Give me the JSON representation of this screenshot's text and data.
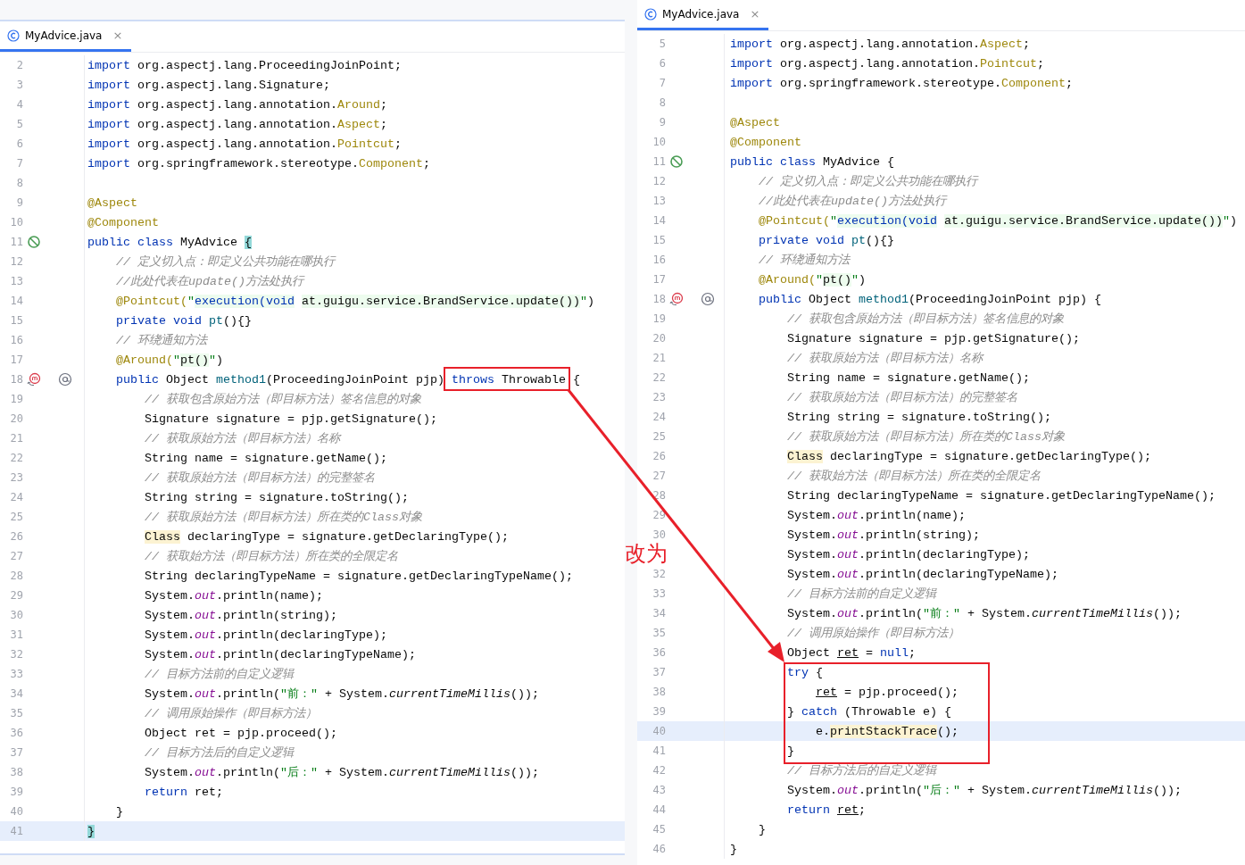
{
  "panes": [
    {
      "tab": {
        "title": "MyAdvice.java",
        "close": "×",
        "selected": true
      },
      "lines": [
        {
          "n": "2",
          "current": false,
          "toks": [
            {
              "text": "import",
              "kind": "kw"
            },
            {
              "text": " org.aspectj.lang.ProceedingJoinPoint;",
              "kind": "plain"
            }
          ]
        },
        {
          "n": "3",
          "current": false,
          "toks": [
            {
              "text": "import",
              "kind": "kw"
            },
            {
              "text": " org.aspectj.lang.Signature;",
              "kind": "plain"
            }
          ]
        },
        {
          "n": "4",
          "current": false,
          "toks": [
            {
              "text": "import",
              "kind": "kw"
            },
            {
              "text": " org.aspectj.lang.annotation.",
              "kind": "plain"
            },
            {
              "text": "Around",
              "kind": "ann"
            },
            {
              "text": ";",
              "kind": "plain"
            }
          ]
        },
        {
          "n": "5",
          "current": false,
          "toks": [
            {
              "text": "import",
              "kind": "kw"
            },
            {
              "text": " org.aspectj.lang.annotation.",
              "kind": "plain"
            },
            {
              "text": "Aspect",
              "kind": "ann"
            },
            {
              "text": ";",
              "kind": "plain"
            }
          ]
        },
        {
          "n": "6",
          "current": false,
          "toks": [
            {
              "text": "import",
              "kind": "kw"
            },
            {
              "text": " org.aspectj.lang.annotation.",
              "kind": "plain"
            },
            {
              "text": "Pointcut",
              "kind": "ann"
            },
            {
              "text": ";",
              "kind": "plain"
            }
          ]
        },
        {
          "n": "7",
          "current": false,
          "toks": [
            {
              "text": "import",
              "kind": "kw"
            },
            {
              "text": " org.springframework.stereotype.",
              "kind": "plain"
            },
            {
              "text": "Component",
              "kind": "ann"
            },
            {
              "text": ";",
              "kind": "plain"
            }
          ]
        },
        {
          "n": "8",
          "current": false
        },
        {
          "n": "9",
          "current": false,
          "toks": [
            {
              "text": "@Aspect",
              "kind": "ann"
            }
          ]
        },
        {
          "n": "10",
          "current": false,
          "toks": [
            {
              "text": "@Component",
              "kind": "ann"
            }
          ]
        },
        {
          "n": "11",
          "current": false,
          "icons": [
            {
              "kind": "bean"
            }
          ],
          "toks": [
            {
              "text": "public class",
              "kind": "kw"
            },
            {
              "text": " MyAdvice ",
              "kind": "plain"
            },
            {
              "text": "{",
              "kind": "brace"
            }
          ]
        },
        {
          "n": "12",
          "current": false,
          "toks": [
            {
              "text": "    // 定义切入点：即定义公共功能在哪执行",
              "kind": "cmt"
            }
          ]
        },
        {
          "n": "13",
          "current": false,
          "toks": [
            {
              "text": "    //此处代表在update()方法处执行",
              "kind": "cmt"
            }
          ]
        },
        {
          "n": "14",
          "current": false,
          "toks": [
            {
              "text": "    @Pointcut(",
              "kind": "ann"
            },
            {
              "text": "\"",
              "kind": "str"
            },
            {
              "text": "execution(void",
              "kind": "injkw"
            },
            {
              "text": " at.guigu.service.BrandService.update())",
              "kind": "injplain"
            },
            {
              "text": "\"",
              "kind": "str"
            },
            {
              "text": ")",
              "kind": "plain"
            }
          ]
        },
        {
          "n": "15",
          "current": false,
          "toks": [
            {
              "text": "    private void",
              "kind": "kw"
            },
            {
              "text": " pt",
              "kind": "decl"
            },
            {
              "text": "(){}",
              "kind": "plain"
            }
          ]
        },
        {
          "n": "16",
          "current": false,
          "toks": [
            {
              "text": "    // 环绕通知方法",
              "kind": "cmt"
            }
          ]
        },
        {
          "n": "17",
          "current": false,
          "toks": [
            {
              "text": "    @Around(",
              "kind": "ann"
            },
            {
              "text": "\"",
              "kind": "str"
            },
            {
              "text": "pt()",
              "kind": "injplain"
            },
            {
              "text": "\"",
              "kind": "str"
            },
            {
              "text": ")",
              "kind": "plain"
            }
          ]
        },
        {
          "n": "18",
          "current": false,
          "icons": [
            {
              "kind": "method"
            },
            {
              "kind": "annotation"
            }
          ],
          "toks": [
            {
              "text": "    public",
              "kind": "kw"
            },
            {
              "text": " Object ",
              "kind": "plain"
            },
            {
              "text": "method1",
              "kind": "decl"
            },
            {
              "text": "(ProceedingJoinPoint pjp) ",
              "kind": "plain"
            },
            {
              "text": "throws",
              "kind": "kw"
            },
            {
              "text": " Throwable {",
              "kind": "plain"
            }
          ]
        },
        {
          "n": "19",
          "current": false,
          "toks": [
            {
              "text": "        // 获取包含原始方法（即目标方法）签名信息的对象",
              "kind": "cmt"
            }
          ]
        },
        {
          "n": "20",
          "current": false,
          "toks": [
            {
              "text": "        Signature signature = pjp.getSignature();",
              "kind": "plain"
            }
          ]
        },
        {
          "n": "21",
          "current": false,
          "toks": [
            {
              "text": "        // 获取原始方法（即目标方法）名称",
              "kind": "cmt"
            }
          ]
        },
        {
          "n": "22",
          "current": false,
          "toks": [
            {
              "text": "        String name = signature.getName();",
              "kind": "plain"
            }
          ]
        },
        {
          "n": "23",
          "current": false,
          "toks": [
            {
              "text": "        // 获取原始方法（即目标方法）的完整签名",
              "kind": "cmt"
            }
          ]
        },
        {
          "n": "24",
          "current": false,
          "toks": [
            {
              "text": "        String string = signature.toString();",
              "kind": "plain"
            }
          ]
        },
        {
          "n": "25",
          "current": false,
          "toks": [
            {
              "text": "        // 获取原始方法（即目标方法）所在类的Class对象",
              "kind": "cmt"
            }
          ]
        },
        {
          "n": "26",
          "current": false,
          "toks": [
            {
              "text": "        Class",
              "kind": "warn"
            },
            {
              "text": " declaringType = signature.getDeclaringType();",
              "kind": "plain"
            }
          ]
        },
        {
          "n": "27",
          "current": false,
          "toks": [
            {
              "text": "        // 获取始方法（即目标方法）所在类的全限定名",
              "kind": "cmt"
            }
          ]
        },
        {
          "n": "28",
          "current": false,
          "toks": [
            {
              "text": "        String declaringTypeName = signature.getDeclaringTypeName();",
              "kind": "plain"
            }
          ]
        },
        {
          "n": "29",
          "current": false,
          "toks": [
            {
              "text": "        System.",
              "kind": "plain"
            },
            {
              "text": "out",
              "kind": "field"
            },
            {
              "text": ".println(name);",
              "kind": "plain"
            }
          ]
        },
        {
          "n": "30",
          "current": false,
          "toks": [
            {
              "text": "        System.",
              "kind": "plain"
            },
            {
              "text": "out",
              "kind": "field"
            },
            {
              "text": ".println(string);",
              "kind": "plain"
            }
          ]
        },
        {
          "n": "31",
          "current": false,
          "toks": [
            {
              "text": "        System.",
              "kind": "plain"
            },
            {
              "text": "out",
              "kind": "field"
            },
            {
              "text": ".println(declaringType);",
              "kind": "plain"
            }
          ]
        },
        {
          "n": "32",
          "current": false,
          "toks": [
            {
              "text": "        System.",
              "kind": "plain"
            },
            {
              "text": "out",
              "kind": "field"
            },
            {
              "text": ".println(declaringTypeName);",
              "kind": "plain"
            }
          ]
        },
        {
          "n": "33",
          "current": false,
          "toks": [
            {
              "text": "        // 目标方法前的自定义逻辑",
              "kind": "cmt"
            }
          ]
        },
        {
          "n": "34",
          "current": false,
          "toks": [
            {
              "text": "        System.",
              "kind": "plain"
            },
            {
              "text": "out",
              "kind": "field"
            },
            {
              "text": ".println(",
              "kind": "plain"
            },
            {
              "text": "\"前：\"",
              "kind": "str"
            },
            {
              "text": " + System.",
              "kind": "plain"
            },
            {
              "text": "currentTimeMillis",
              "kind": "static"
            },
            {
              "text": "());",
              "kind": "plain"
            }
          ]
        },
        {
          "n": "35",
          "current": false,
          "toks": [
            {
              "text": "        // 调用原始操作（即目标方法）",
              "kind": "cmt"
            }
          ]
        },
        {
          "n": "36",
          "current": false,
          "toks": [
            {
              "text": "        Object ret = pjp.proceed();",
              "kind": "plain"
            }
          ]
        },
        {
          "n": "37",
          "current": false,
          "toks": [
            {
              "text": "        // 目标方法后的自定义逻辑",
              "kind": "cmt"
            }
          ]
        },
        {
          "n": "38",
          "current": false,
          "toks": [
            {
              "text": "        System.",
              "kind": "plain"
            },
            {
              "text": "out",
              "kind": "field"
            },
            {
              "text": ".println(",
              "kind": "plain"
            },
            {
              "text": "\"后：\"",
              "kind": "str"
            },
            {
              "text": " + System.",
              "kind": "plain"
            },
            {
              "text": "currentTimeMillis",
              "kind": "static"
            },
            {
              "text": "());",
              "kind": "plain"
            }
          ]
        },
        {
          "n": "39",
          "current": false,
          "toks": [
            {
              "text": "        return",
              "kind": "kw"
            },
            {
              "text": " ret;",
              "kind": "plain"
            }
          ]
        },
        {
          "n": "40",
          "current": false,
          "toks": [
            {
              "text": "    }",
              "kind": "plain"
            }
          ]
        },
        {
          "n": "41",
          "current": true,
          "toks": [
            {
              "text": "}",
              "kind": "brace"
            }
          ]
        }
      ]
    },
    {
      "tab": {
        "title": "MyAdvice.java",
        "close": "×",
        "selected": true
      },
      "lines": [
        {
          "n": "5",
          "current": false,
          "toks": [
            {
              "text": "import",
              "kind": "kw"
            },
            {
              "text": " org.aspectj.lang.annotation.",
              "kind": "plain"
            },
            {
              "text": "Aspect",
              "kind": "ann"
            },
            {
              "text": ";",
              "kind": "plain"
            }
          ]
        },
        {
          "n": "6",
          "current": false,
          "toks": [
            {
              "text": "import",
              "kind": "kw"
            },
            {
              "text": " org.aspectj.lang.annotation.",
              "kind": "plain"
            },
            {
              "text": "Pointcut",
              "kind": "ann"
            },
            {
              "text": ";",
              "kind": "plain"
            }
          ]
        },
        {
          "n": "7",
          "current": false,
          "toks": [
            {
              "text": "import",
              "kind": "kw"
            },
            {
              "text": " org.springframework.stereotype.",
              "kind": "plain"
            },
            {
              "text": "Component",
              "kind": "ann"
            },
            {
              "text": ";",
              "kind": "plain"
            }
          ]
        },
        {
          "n": "8",
          "current": false
        },
        {
          "n": "9",
          "current": false,
          "toks": [
            {
              "text": "@Aspect",
              "kind": "ann"
            }
          ]
        },
        {
          "n": "10",
          "current": false,
          "toks": [
            {
              "text": "@Component",
              "kind": "ann"
            }
          ]
        },
        {
          "n": "11",
          "current": false,
          "icons": [
            {
              "kind": "bean"
            }
          ],
          "toks": [
            {
              "text": "public class",
              "kind": "kw"
            },
            {
              "text": " MyAdvice {",
              "kind": "plain"
            }
          ]
        },
        {
          "n": "12",
          "current": false,
          "toks": [
            {
              "text": "    // 定义切入点：即定义公共功能在哪执行",
              "kind": "cmt"
            }
          ]
        },
        {
          "n": "13",
          "current": false,
          "toks": [
            {
              "text": "    //此处代表在update()方法处执行",
              "kind": "cmt"
            }
          ]
        },
        {
          "n": "14",
          "current": false,
          "toks": [
            {
              "text": "    @Pointcut(",
              "kind": "ann"
            },
            {
              "text": "\"",
              "kind": "str"
            },
            {
              "text": "execution(void",
              "kind": "injkw"
            },
            {
              "text": " at.guigu.service.BrandService.update())",
              "kind": "injplain"
            },
            {
              "text": "\"",
              "kind": "str"
            },
            {
              "text": ")",
              "kind": "plain"
            }
          ]
        },
        {
          "n": "15",
          "current": false,
          "toks": [
            {
              "text": "    private void",
              "kind": "kw"
            },
            {
              "text": " pt",
              "kind": "decl"
            },
            {
              "text": "(){}",
              "kind": "plain"
            }
          ]
        },
        {
          "n": "16",
          "current": false,
          "toks": [
            {
              "text": "    // 环绕通知方法",
              "kind": "cmt"
            }
          ]
        },
        {
          "n": "17",
          "current": false,
          "toks": [
            {
              "text": "    @Around(",
              "kind": "ann"
            },
            {
              "text": "\"",
              "kind": "str"
            },
            {
              "text": "pt()",
              "kind": "injplain"
            },
            {
              "text": "\"",
              "kind": "str"
            },
            {
              "text": ")",
              "kind": "plain"
            }
          ]
        },
        {
          "n": "18",
          "current": false,
          "icons": [
            {
              "kind": "method"
            },
            {
              "kind": "annotation"
            }
          ],
          "toks": [
            {
              "text": "    public",
              "kind": "kw"
            },
            {
              "text": " Object ",
              "kind": "plain"
            },
            {
              "text": "method1",
              "kind": "decl"
            },
            {
              "text": "(ProceedingJoinPoint pjp) {",
              "kind": "plain"
            }
          ]
        },
        {
          "n": "19",
          "current": false,
          "toks": [
            {
              "text": "        // 获取包含原始方法（即目标方法）签名信息的对象",
              "kind": "cmt"
            }
          ]
        },
        {
          "n": "20",
          "current": false,
          "toks": [
            {
              "text": "        Signature signature = pjp.getSignature();",
              "kind": "plain"
            }
          ]
        },
        {
          "n": "21",
          "current": false,
          "toks": [
            {
              "text": "        // 获取原始方法（即目标方法）名称",
              "kind": "cmt"
            }
          ]
        },
        {
          "n": "22",
          "current": false,
          "toks": [
            {
              "text": "        String name = signature.getName();",
              "kind": "plain"
            }
          ]
        },
        {
          "n": "23",
          "current": false,
          "toks": [
            {
              "text": "        // 获取原始方法（即目标方法）的完整签名",
              "kind": "cmt"
            }
          ]
        },
        {
          "n": "24",
          "current": false,
          "toks": [
            {
              "text": "        String string = signature.toString();",
              "kind": "plain"
            }
          ]
        },
        {
          "n": "25",
          "current": false,
          "toks": [
            {
              "text": "        // 获取原始方法（即目标方法）所在类的Class对象",
              "kind": "cmt"
            }
          ]
        },
        {
          "n": "26",
          "current": false,
          "toks": [
            {
              "text": "        Class",
              "kind": "warn"
            },
            {
              "text": " declaringType = signature.getDeclaringType();",
              "kind": "plain"
            }
          ]
        },
        {
          "n": "27",
          "current": false,
          "toks": [
            {
              "text": "        // 获取始方法（即目标方法）所在类的全限定名",
              "kind": "cmt"
            }
          ]
        },
        {
          "n": "28",
          "current": false,
          "toks": [
            {
              "text": "        String declaringTypeName = signature.getDeclaringTypeName();",
              "kind": "plain"
            }
          ]
        },
        {
          "n": "29",
          "current": false,
          "toks": [
            {
              "text": "        System.",
              "kind": "plain"
            },
            {
              "text": "out",
              "kind": "field"
            },
            {
              "text": ".println(name);",
              "kind": "plain"
            }
          ]
        },
        {
          "n": "30",
          "current": false,
          "toks": [
            {
              "text": "        System.",
              "kind": "plain"
            },
            {
              "text": "out",
              "kind": "field"
            },
            {
              "text": ".println(string);",
              "kind": "plain"
            }
          ]
        },
        {
          "current": false,
          "toks": [
            {
              "text": "        System.",
              "kind": "plain"
            },
            {
              "text": "out",
              "kind": "field"
            },
            {
              "text": ".println(declaringType);",
              "kind": "plain"
            }
          ]
        },
        {
          "n": "32",
          "current": false,
          "toks": [
            {
              "text": "        System.",
              "kind": "plain"
            },
            {
              "text": "out",
              "kind": "field"
            },
            {
              "text": ".println(declaringTypeName);",
              "kind": "plain"
            }
          ]
        },
        {
          "n": "33",
          "current": false,
          "toks": [
            {
              "text": "        // 目标方法前的自定义逻辑",
              "kind": "cmt"
            }
          ]
        },
        {
          "n": "34",
          "current": false,
          "toks": [
            {
              "text": "        System.",
              "kind": "plain"
            },
            {
              "text": "out",
              "kind": "field"
            },
            {
              "text": ".println(",
              "kind": "plain"
            },
            {
              "text": "\"前：\"",
              "kind": "str"
            },
            {
              "text": " + System.",
              "kind": "plain"
            },
            {
              "text": "currentTimeMillis",
              "kind": "static"
            },
            {
              "text": "());",
              "kind": "plain"
            }
          ]
        },
        {
          "n": "35",
          "current": false,
          "toks": [
            {
              "text": "        // 调用原始操作（即目标方法）",
              "kind": "cmt"
            }
          ]
        },
        {
          "n": "36",
          "current": false,
          "toks": [
            {
              "text": "        Object ",
              "kind": "plain"
            },
            {
              "text": "ret",
              "kind": "under"
            },
            {
              "text": " = ",
              "kind": "plain"
            },
            {
              "text": "null",
              "kind": "kw"
            },
            {
              "text": ";",
              "kind": "plain"
            }
          ]
        },
        {
          "n": "37",
          "current": false,
          "toks": [
            {
              "text": "        try",
              "kind": "kw"
            },
            {
              "text": " {",
              "kind": "plain"
            }
          ]
        },
        {
          "n": "38",
          "current": false,
          "toks": [
            {
              "text": "            ret",
              "kind": "under"
            },
            {
              "text": " = pjp.proceed();",
              "kind": "plain"
            }
          ]
        },
        {
          "n": "39",
          "current": false,
          "toks": [
            {
              "text": "        } ",
              "kind": "plain"
            },
            {
              "text": "catch",
              "kind": "kw"
            },
            {
              "text": " (Throwable e) {",
              "kind": "plain"
            }
          ]
        },
        {
          "n": "40",
          "current": true,
          "toks": [
            {
              "text": "            e.",
              "kind": "plain"
            },
            {
              "text": "printStackTrace",
              "kind": "warn"
            },
            {
              "text": "();",
              "kind": "plain"
            }
          ]
        },
        {
          "n": "41",
          "current": false,
          "toks": [
            {
              "text": "        }",
              "kind": "plain"
            }
          ]
        },
        {
          "n": "42",
          "current": false,
          "toks": [
            {
              "text": "        // 目标方法后的自定义逻辑",
              "kind": "cmt"
            }
          ]
        },
        {
          "n": "43",
          "current": false,
          "toks": [
            {
              "text": "        System.",
              "kind": "plain"
            },
            {
              "text": "out",
              "kind": "field"
            },
            {
              "text": ".println(",
              "kind": "plain"
            },
            {
              "text": "\"后：\"",
              "kind": "str"
            },
            {
              "text": " + System.",
              "kind": "plain"
            },
            {
              "text": "currentTimeMillis",
              "kind": "static"
            },
            {
              "text": "());",
              "kind": "plain"
            }
          ]
        },
        {
          "n": "44",
          "current": false,
          "toks": [
            {
              "text": "        return",
              "kind": "kw"
            },
            {
              "text": " ret",
              "kind": "under"
            },
            {
              "text": ";",
              "kind": "plain"
            }
          ]
        },
        {
          "n": "45",
          "current": false,
          "toks": [
            {
              "text": "    }",
              "kind": "plain"
            }
          ]
        },
        {
          "n": "46",
          "current": false,
          "toks": [
            {
              "text": "}",
              "kind": "plain"
            }
          ]
        }
      ]
    }
  ],
  "annotation": {
    "label": "改为"
  }
}
